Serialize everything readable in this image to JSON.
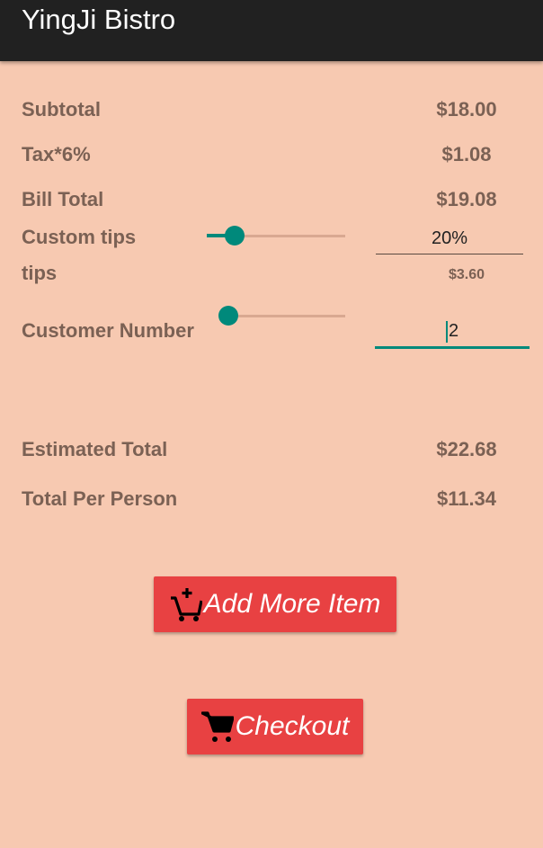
{
  "app": {
    "title": "YingJi Bistro"
  },
  "summary": {
    "subtotal_label": "Subtotal",
    "subtotal_value": "$18.00",
    "tax_label": "Tax*6%",
    "tax_value": "$1.08",
    "bill_total_label": "Bill Total",
    "bill_total_value": "$19.08",
    "custom_tips_label": "Custom tips",
    "custom_tips_value": "20%",
    "tips_label": "tips",
    "tips_value": "$3.60",
    "customer_number_label": "Customer Number",
    "customer_number_value": "2",
    "estimated_total_label": "Estimated Total",
    "estimated_total_value": "$22.68",
    "per_person_label": "Total Per Person",
    "per_person_value": "$11.34"
  },
  "sliders": {
    "tips_level": 0.2,
    "customer_level": 0.0
  },
  "buttons": {
    "add_more_label": "Add More Item",
    "add_more_icon": "add-shopping-cart-icon",
    "checkout_label": "Checkout",
    "checkout_icon": "shopping-cart-icon"
  },
  "colors": {
    "background": "#f7c9b1",
    "appbar": "#212121",
    "accent": "#00897b",
    "button": "#e84142",
    "label_text": "#7b6154"
  }
}
